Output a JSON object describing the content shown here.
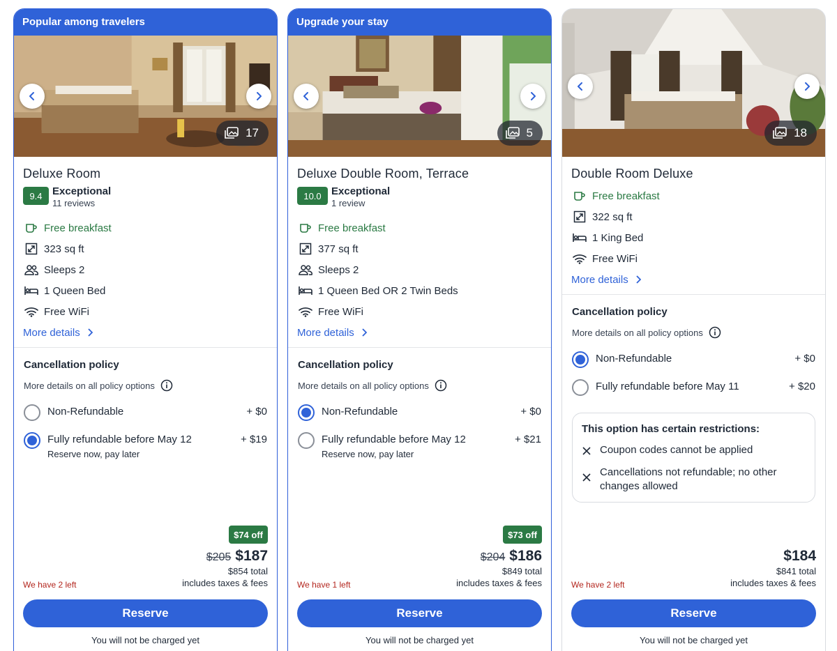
{
  "cards": [
    {
      "banner": "Popular among travelers",
      "photo_count": "17",
      "title": "Deluxe Room",
      "rating": {
        "score": "9.4",
        "word": "Exceptional",
        "reviews": "11 reviews"
      },
      "amenities": [
        {
          "icon": "coffee-cup-icon",
          "text": "Free breakfast"
        },
        {
          "icon": "area-expand-icon",
          "text": "323 sq ft"
        },
        {
          "icon": "people-icon",
          "text": "Sleeps 2"
        },
        {
          "icon": "bed-icon",
          "text": "1 Queen Bed"
        },
        {
          "icon": "wifi-icon",
          "text": "Free WiFi"
        }
      ],
      "more_details": "More details",
      "cancellation_title": "Cancellation policy",
      "policy_note": "More details on all policy options",
      "options": [
        {
          "label": "Non-Refundable",
          "price": "+ $0",
          "sub": "",
          "selected": false
        },
        {
          "label": "Fully refundable before May 12",
          "price": "+ $19",
          "sub": "Reserve now, pay later",
          "selected": true
        }
      ],
      "discount": "$74 off",
      "old_price": "$205",
      "price": "$187",
      "total": "$854 total",
      "taxes": "includes taxes & fees",
      "left": "We have 2 left",
      "reserve": "Reserve",
      "no_charge": "You will not be charged yet"
    },
    {
      "banner": "Upgrade your stay",
      "photo_count": "5",
      "title": "Deluxe Double Room, Terrace",
      "rating": {
        "score": "10.0",
        "word": "Exceptional",
        "reviews": "1 review"
      },
      "amenities": [
        {
          "icon": "coffee-cup-icon",
          "text": "Free breakfast"
        },
        {
          "icon": "area-expand-icon",
          "text": "377 sq ft"
        },
        {
          "icon": "people-icon",
          "text": "Sleeps 2"
        },
        {
          "icon": "bed-icon",
          "text": "1 Queen Bed OR 2 Twin Beds"
        },
        {
          "icon": "wifi-icon",
          "text": "Free WiFi"
        }
      ],
      "more_details": "More details",
      "cancellation_title": "Cancellation policy",
      "policy_note": "More details on all policy options",
      "options": [
        {
          "label": "Non-Refundable",
          "price": "+ $0",
          "sub": "",
          "selected": true
        },
        {
          "label": "Fully refundable before May 12",
          "price": "+ $21",
          "sub": "Reserve now, pay later",
          "selected": false
        }
      ],
      "discount": "$73 off",
      "old_price": "$204",
      "price": "$186",
      "total": "$849 total",
      "taxes": "includes taxes & fees",
      "left": "We have 1 left",
      "reserve": "Reserve",
      "no_charge": "You will not be charged yet"
    },
    {
      "banner": "",
      "photo_count": "18",
      "title": "Double Room Deluxe",
      "amenities": [
        {
          "icon": "coffee-cup-icon",
          "text": "Free breakfast"
        },
        {
          "icon": "area-expand-icon",
          "text": "322 sq ft"
        },
        {
          "icon": "bed-icon",
          "text": "1 King Bed"
        },
        {
          "icon": "wifi-icon",
          "text": "Free WiFi"
        }
      ],
      "more_details": "More details",
      "cancellation_title": "Cancellation policy",
      "policy_note": "More details on all policy options",
      "options": [
        {
          "label": "Non-Refundable",
          "price": "+ $0",
          "sub": "",
          "selected": true
        },
        {
          "label": "Fully refundable before May 11",
          "price": "+ $20",
          "sub": "",
          "selected": false
        }
      ],
      "restrictions": {
        "title": "This option has certain restrictions:",
        "items": [
          "Coupon codes cannot be applied",
          "Cancellations not refundable; no other changes allowed"
        ]
      },
      "price": "$184",
      "total": "$841 total",
      "taxes": "includes taxes & fees",
      "left": "We have 2 left",
      "reserve": "Reserve",
      "no_charge": "You will not be charged yet"
    }
  ],
  "colors": {
    "accent": "#2f62d8",
    "rating_green": "#2b7a44",
    "urgency_red": "#b3261e"
  }
}
